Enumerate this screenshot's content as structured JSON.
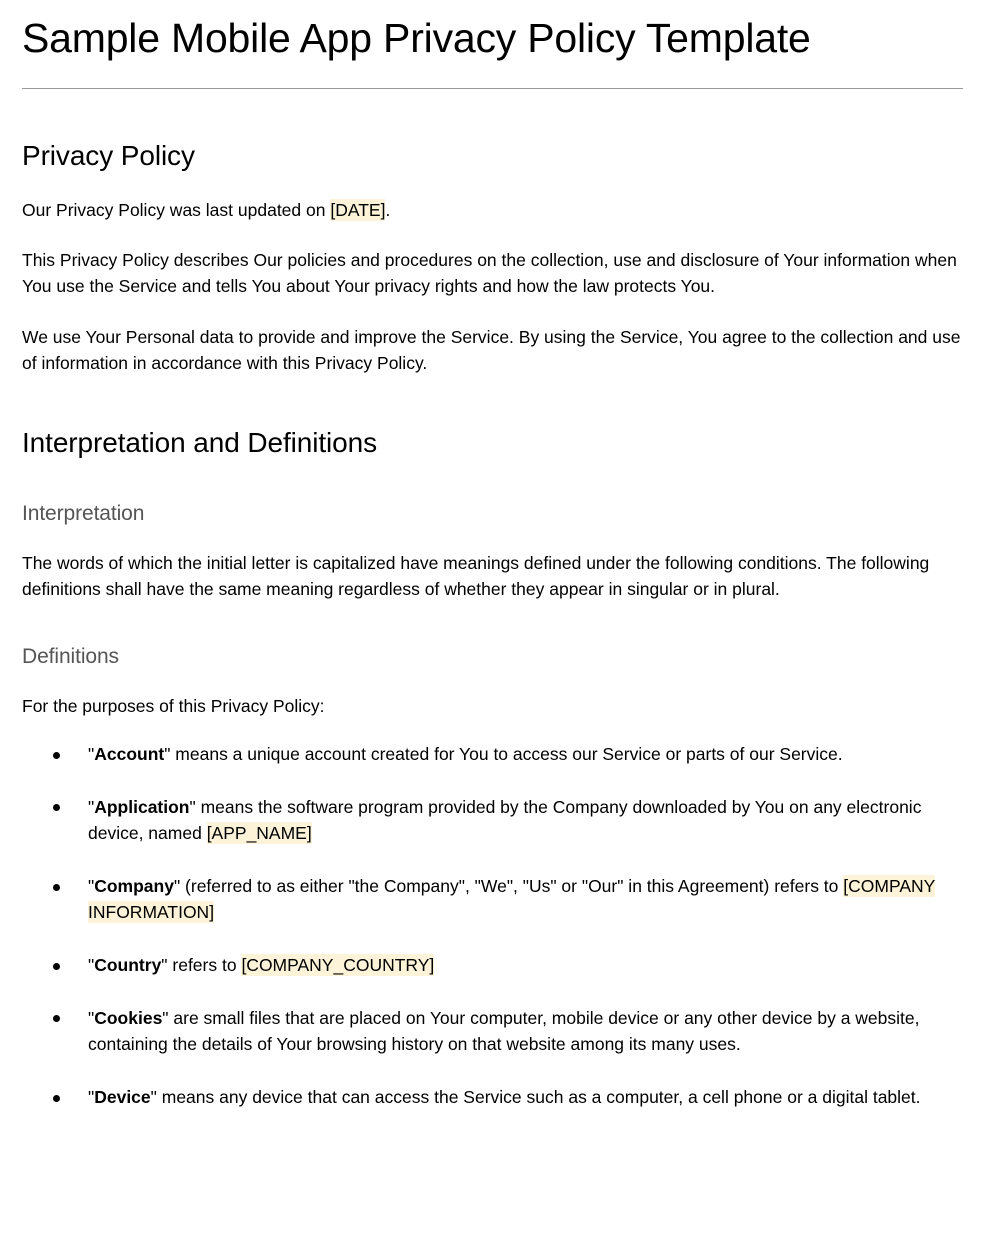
{
  "document": {
    "title": "Sample Mobile App Privacy Policy Template",
    "highlight_color": "#fcf3d9",
    "rule_color": "#999999",
    "subheading_color": "#555555"
  },
  "privacy_policy": {
    "heading": "Privacy Policy",
    "last_updated_prefix": "Our Privacy Policy was last updated on ",
    "last_updated_placeholder": "[DATE]",
    "last_updated_suffix": ".",
    "paragraph_1": "This Privacy Policy describes Our policies and procedures on the collection, use and disclosure of Your information when You use the Service and tells You about Your privacy rights and how the law protects You.",
    "paragraph_2": "We use Your Personal data to provide and improve the Service. By using the Service, You agree to the collection and use of information in accordance with this Privacy Policy."
  },
  "interpretation_and_definitions": {
    "heading": "Interpretation and Definitions",
    "interpretation": {
      "heading": "Interpretation",
      "paragraph": "The words of which the initial letter is capitalized have meanings defined under the following conditions. The following definitions shall have the same meaning regardless of whether they appear in singular or in plural."
    },
    "definitions": {
      "heading": "Definitions",
      "intro": "For the purposes of this Privacy Policy:",
      "items": [
        {
          "quote_open": "\"",
          "term": "Account",
          "quote_close": "\"",
          "text_before": " means a unique account created for You to access our Service or parts of our Service.",
          "placeholder": "",
          "text_after": ""
        },
        {
          "quote_open": "\"",
          "term": "Application",
          "quote_close": "\"",
          "text_before": " means the software program provided by the Company downloaded by You on any electronic device, named ",
          "placeholder": "[APP_NAME]",
          "text_after": ""
        },
        {
          "quote_open": "\"",
          "term": "Company",
          "quote_close": "\"",
          "text_before": " (referred to as either \"the Company\", \"We\", \"Us\" or \"Our\" in this Agreement) refers to ",
          "placeholder": "[COMPANY INFORMATION]",
          "text_after": ""
        },
        {
          "quote_open": "\"",
          "term": "Country",
          "quote_close": "\"",
          "text_before": " refers to ",
          "placeholder": "[COMPANY_COUNTRY]",
          "text_after": ""
        },
        {
          "quote_open": "\"",
          "term": "Cookies",
          "quote_close": "\"",
          "text_before": " are small files that are placed on Your computer, mobile device or any other device by a website, containing the details of Your browsing history on that website among its many uses.",
          "placeholder": "",
          "text_after": ""
        },
        {
          "quote_open": "\"",
          "term": "Device",
          "quote_close": "\"",
          "text_before": " means any device that can access the Service such as a computer, a cell phone or a digital tablet.",
          "placeholder": "",
          "text_after": ""
        }
      ]
    }
  }
}
